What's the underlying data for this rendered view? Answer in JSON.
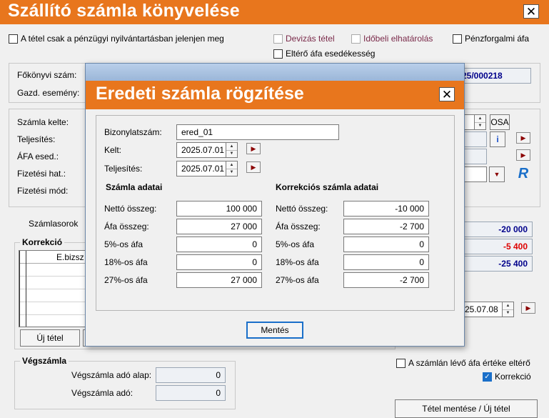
{
  "window": {
    "title": "Szállító számla könyvelése",
    "close_glyph": "✕"
  },
  "top_options": {
    "only_financial": "A tétel csak a pénzügyi nyilvántartásban jelenjen meg",
    "currency_item": "Devizás tétel",
    "time_accrual": "Időbeli elhatárolás",
    "cash_vat": "Pénzforgalmi áfa",
    "different_vat_due": "Eltérő áfa esedékesség"
  },
  "header": {
    "ledger_label": "Főkönyvi szám:",
    "event_label": "Gazd. esemény:",
    "doc_number_partial": "25/000218"
  },
  "dates": {
    "invoice_date_label": "Számla kelte:",
    "fulfillment_label": "Teljesítés:",
    "vat_due_label": "ÁFA esed.:",
    "payment_due_label": "Fizetési hat.:",
    "payment_method_label": "Fizetési mód:",
    "osa_button": "OSA",
    "info_glyph": "i",
    "date_partial": "25.07.08"
  },
  "tabs": {
    "invoice_rows": "Számlasorok"
  },
  "correction": {
    "title": "Korrekció",
    "col_doc_number": "E.bizsz",
    "new_item_button": "Új tétel"
  },
  "summary_values": {
    "net": "-20 000",
    "vat": "-5 400",
    "gross": "-25 400"
  },
  "final_invoice": {
    "title": "Végszámla",
    "tax_base_label": "Végszámla adó alap:",
    "tax_base_value": "0",
    "tax_label": "Végszámla adó:",
    "tax_value": "0"
  },
  "bottom_options": {
    "vat_differs": "A számlán lévő áfa értéke eltérő",
    "correction": "Korrekció",
    "correction_checked": true
  },
  "save_new_button": "Tétel mentése / Új tétel",
  "modal": {
    "title": "Eredeti számla rögzítése",
    "close_glyph": "✕",
    "doc_number_label": "Bizonylatszám:",
    "doc_number_value": "ered_01",
    "date_label": "Kelt:",
    "date_value": "2025.07.01",
    "fulfillment_label": "Teljesítés:",
    "fulfillment_value": "2025.07.01",
    "invoice_section": "Számla adatai",
    "correction_section": "Korrekciós számla adatai",
    "rows": [
      {
        "label": "Nettó összeg:",
        "invoice": "100 000",
        "correction": "-10 000"
      },
      {
        "label": "Áfa összeg:",
        "invoice": "27 000",
        "correction": "-2 700"
      },
      {
        "label": "5%-os áfa",
        "invoice": "0",
        "correction": "0"
      },
      {
        "label": "18%-os áfa",
        "invoice": "0",
        "correction": "0"
      },
      {
        "label": "27%-os áfa",
        "invoice": "27 000",
        "correction": "-2 700"
      }
    ],
    "save_button": "Mentés"
  },
  "colors": {
    "title_orange": "#e8761d",
    "value_blue": "#00008b",
    "value_red": "#dd0000",
    "checkbox_blue": "#1a6fc9"
  }
}
